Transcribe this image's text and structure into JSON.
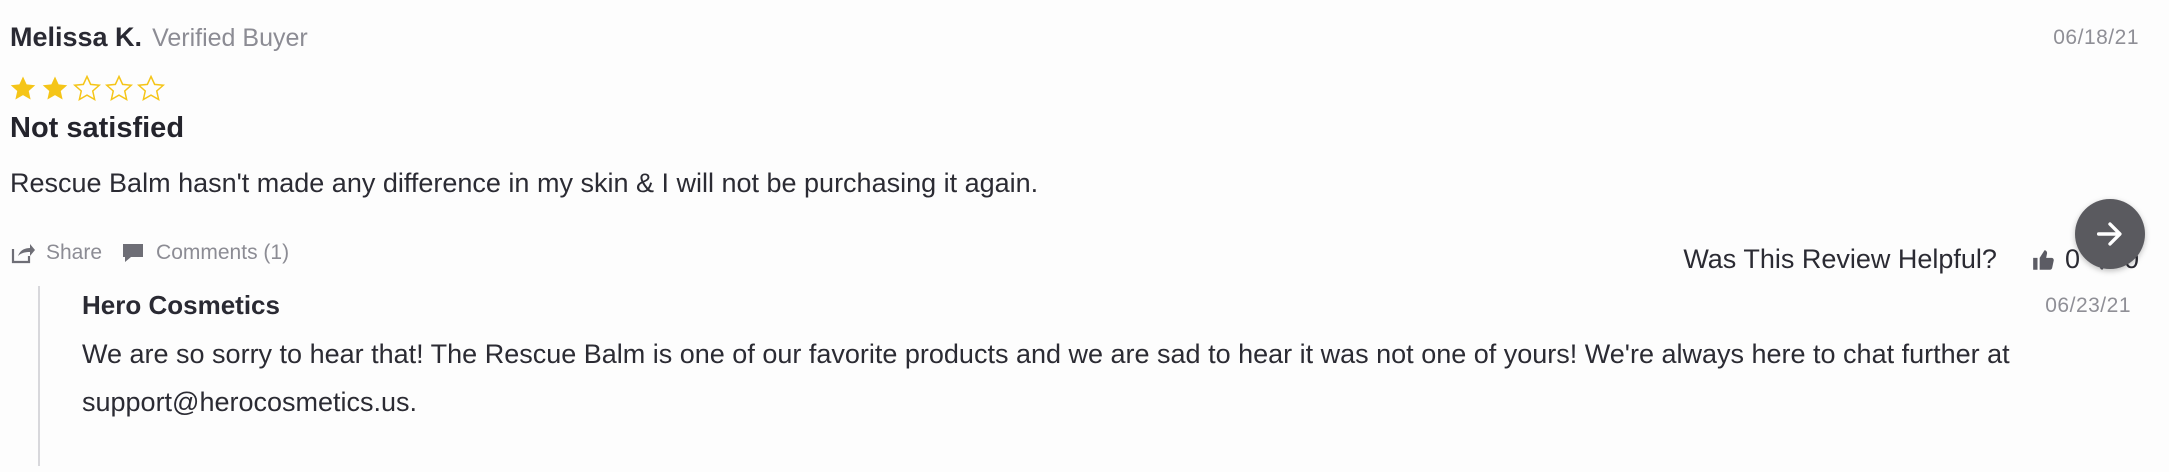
{
  "review": {
    "author": "Melissa K.",
    "badge": "Verified Buyer",
    "date": "06/18/21",
    "rating": 2,
    "max_rating": 5,
    "star_color": "#f5c518",
    "title": "Not satisfied",
    "body": "Rescue Balm hasn't made any difference in my skin & I will not be purchasing it again.",
    "share_label": "Share",
    "comments_label": "Comments (1)"
  },
  "helpful": {
    "label": "Was This Review Helpful?",
    "up_count": "0",
    "down_count": "0"
  },
  "reply": {
    "author": "Hero Cosmetics",
    "date": "06/23/21",
    "text": "We are so sorry to hear that! The Rescue Balm is one of our favorite products and we are sad to hear it was not one of yours! We're always here to chat further at support@herocosmetics.us."
  },
  "icons": {
    "share": "share-icon",
    "comments": "comment-icon",
    "thumbs_up": "thumbs-up-icon",
    "thumbs_down": "thumbs-down-icon",
    "next": "arrow-right-icon"
  }
}
